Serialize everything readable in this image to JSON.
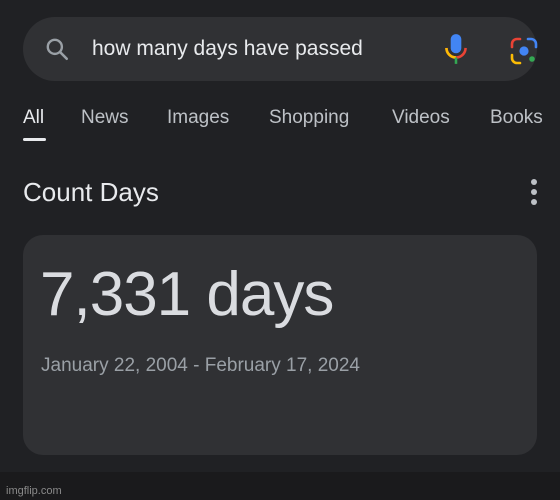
{
  "search": {
    "query": "how many days have passed",
    "icon": "search-icon"
  },
  "tabs": [
    {
      "label": "All",
      "active": true
    },
    {
      "label": "News"
    },
    {
      "label": "Images"
    },
    {
      "label": "Shopping"
    },
    {
      "label": "Videos"
    },
    {
      "label": "Books"
    }
  ],
  "section": {
    "title": "Count Days"
  },
  "result": {
    "value": "7,331 days",
    "range": "January 22, 2004 - February 17, 2024"
  },
  "watermark": "imgflip.com",
  "colors": {
    "background": "#202124",
    "surface": "#303134",
    "text_primary": "#e8eaed",
    "text_secondary": "#9aa0a6"
  }
}
